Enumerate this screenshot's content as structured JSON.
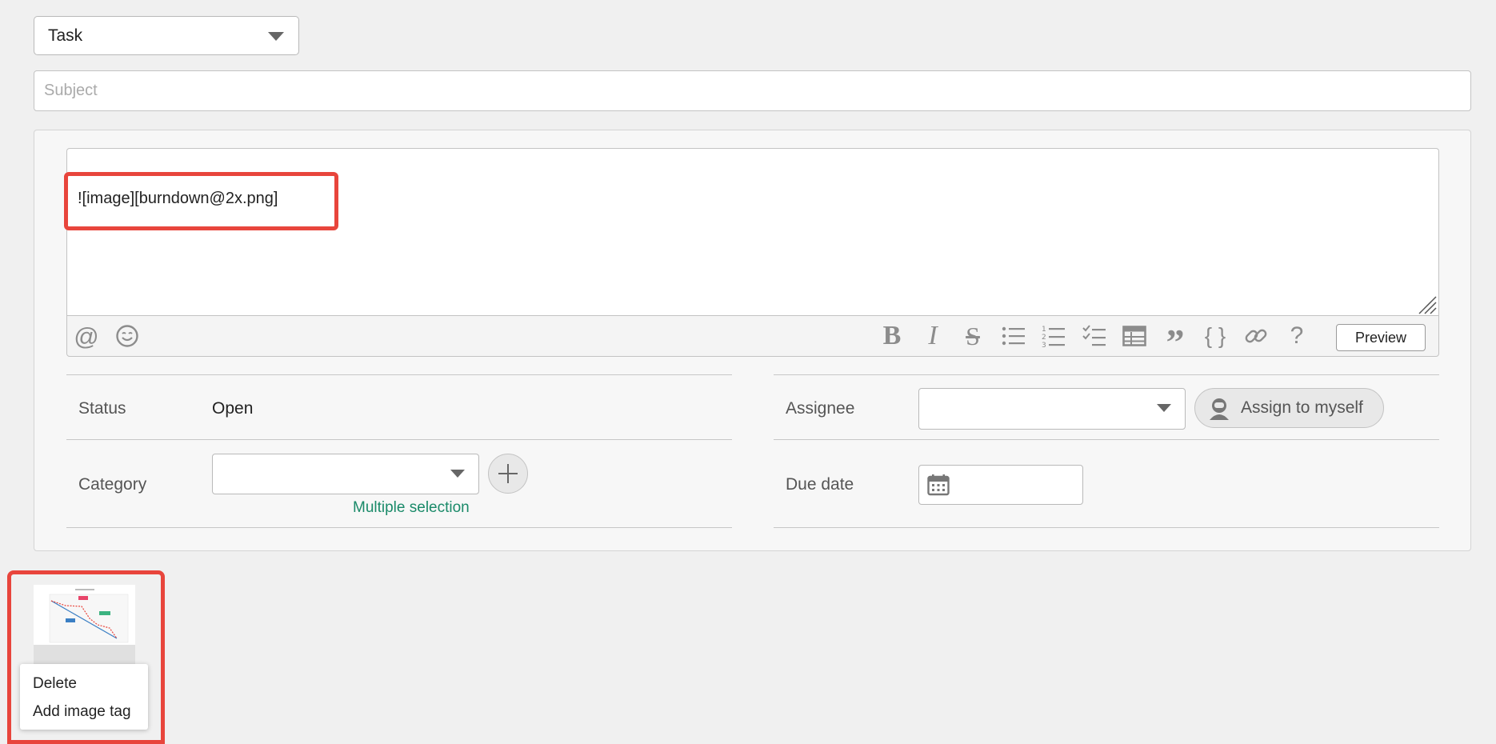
{
  "issue_type": {
    "selected": "Task"
  },
  "subject": {
    "placeholder": "Subject",
    "value": ""
  },
  "editor": {
    "text": "![image][burndown@2x.png]"
  },
  "toolbar": {
    "left_icons": [
      "mention-icon",
      "emoji-icon"
    ],
    "right_icons": [
      "bold-icon",
      "italic-icon",
      "strikethrough-icon",
      "bullet-list-icon",
      "numbered-list-icon",
      "checklist-icon",
      "table-icon",
      "quote-icon",
      "code-icon",
      "link-icon",
      "help-icon"
    ],
    "preview_label": "Preview"
  },
  "fields": {
    "status_label": "Status",
    "status_value": "Open",
    "category_label": "Category",
    "category_value": "",
    "multiple_selection_link": "Multiple selection",
    "assignee_label": "Assignee",
    "assignee_value": "",
    "assign_to_myself_label": "Assign to myself",
    "due_date_label": "Due date",
    "due_date_value": ""
  },
  "attachment": {
    "thumbnail": "burndown-chart-thumbnail",
    "menu": {
      "delete_label": "Delete",
      "add_image_tag_label": "Add image tag"
    }
  },
  "colors": {
    "highlight": "#e8453c",
    "link": "#1a8a69",
    "background": "#f0f0f0"
  }
}
